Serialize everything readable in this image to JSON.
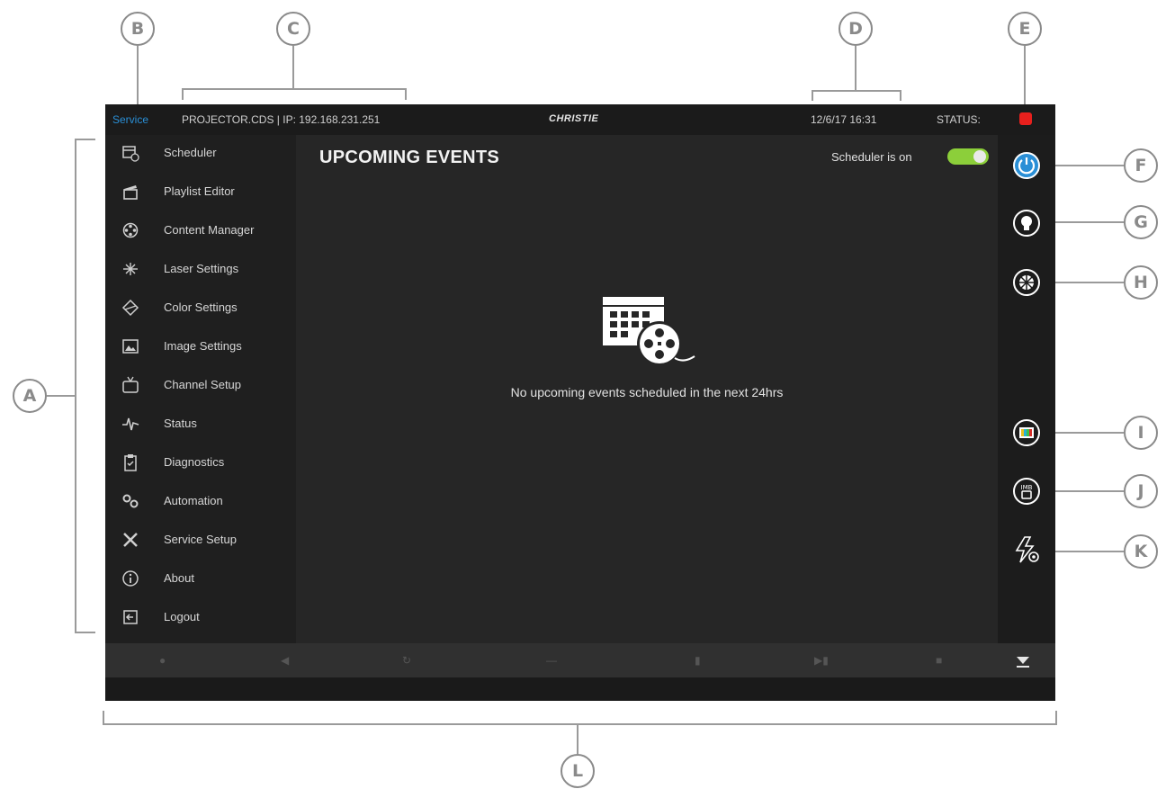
{
  "topbar": {
    "mode_label": "Service",
    "projector_info": "PROJECTOR.CDS | IP: 192.168.231.251",
    "logo": "CHRISTIE",
    "date_time": "12/6/17  16:31",
    "status_label": "STATUS:",
    "status_color": "#e8201d"
  },
  "sidebar": {
    "items": [
      {
        "label": "Scheduler",
        "icon": "scheduler-icon"
      },
      {
        "label": "Playlist Editor",
        "icon": "clapperboard-icon"
      },
      {
        "label": "Content Manager",
        "icon": "film-reel-icon"
      },
      {
        "label": "Laser Settings",
        "icon": "laser-icon"
      },
      {
        "label": "Color Settings",
        "icon": "color-prism-icon"
      },
      {
        "label": "Image Settings",
        "icon": "image-icon"
      },
      {
        "label": "Channel Setup",
        "icon": "tv-icon"
      },
      {
        "label": "Status",
        "icon": "pulse-icon"
      },
      {
        "label": "Diagnostics",
        "icon": "clipboard-icon"
      },
      {
        "label": "Automation",
        "icon": "gears-icon"
      },
      {
        "label": "Service Setup",
        "icon": "tools-icon"
      },
      {
        "label": "About",
        "icon": "info-icon"
      },
      {
        "label": "Logout",
        "icon": "logout-icon"
      }
    ]
  },
  "main": {
    "title": "UPCOMING EVENTS",
    "scheduler_label": "Scheduler is on",
    "scheduler_on": true,
    "empty_message": "No upcoming events scheduled in the next 24hrs"
  },
  "rail": {
    "buttons": [
      {
        "icon": "power-icon"
      },
      {
        "icon": "lamp-icon"
      },
      {
        "icon": "douser-icon"
      },
      {
        "icon": "test-pattern-icon"
      },
      {
        "icon": "imb-icon"
      },
      {
        "icon": "power-settings-icon"
      }
    ]
  },
  "callouts": {
    "labels": [
      "A",
      "B",
      "C",
      "D",
      "E",
      "F",
      "G",
      "H",
      "I",
      "J",
      "K",
      "L"
    ]
  },
  "colors": {
    "accent_blue": "#2a8fd6",
    "toggle_green": "#8ccf3a",
    "status_red": "#e8201d"
  }
}
